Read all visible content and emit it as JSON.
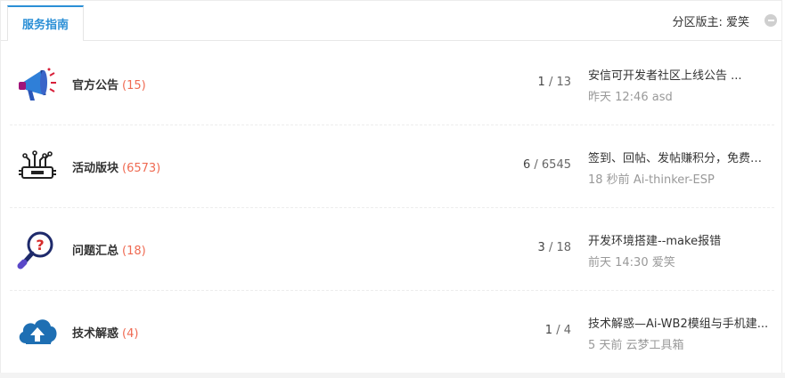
{
  "header": {
    "tab_label": "服务指南",
    "moderator_label": "分区版主:",
    "moderator_name": "爱笑"
  },
  "forums": [
    {
      "icon": "megaphone-icon",
      "name": "官方公告",
      "count": "(15)",
      "threads": "1",
      "posts": "13",
      "last_title": "安信可开发者社区上线公告 ...",
      "last_time": "昨天 12:46",
      "last_user": "asd"
    },
    {
      "icon": "circuit-board-icon",
      "name": "活动版块",
      "count": "(6573)",
      "threads": "6",
      "posts": "6545",
      "last_title": "签到、回帖、发帖赚积分，免费兑 ...",
      "last_time": "18 秒前",
      "last_user": "Ai-thinker-ESP"
    },
    {
      "icon": "question-magnifier-icon",
      "name": "问题汇总",
      "count": "(18)",
      "threads": "3",
      "posts": "18",
      "last_title": "开发环境搭建--make报错",
      "last_time": "前天 14:30",
      "last_user": "爱笑"
    },
    {
      "icon": "cloud-upload-icon",
      "name": "技术解惑",
      "count": "(4)",
      "threads": "1",
      "posts": "4",
      "last_title": "技术解惑—Ai-WB2模组与手机建...",
      "last_time": "5 天前",
      "last_user": "云梦工具箱"
    }
  ],
  "colors": {
    "accent": "#2b8fd6",
    "count": "#ef6a52"
  }
}
